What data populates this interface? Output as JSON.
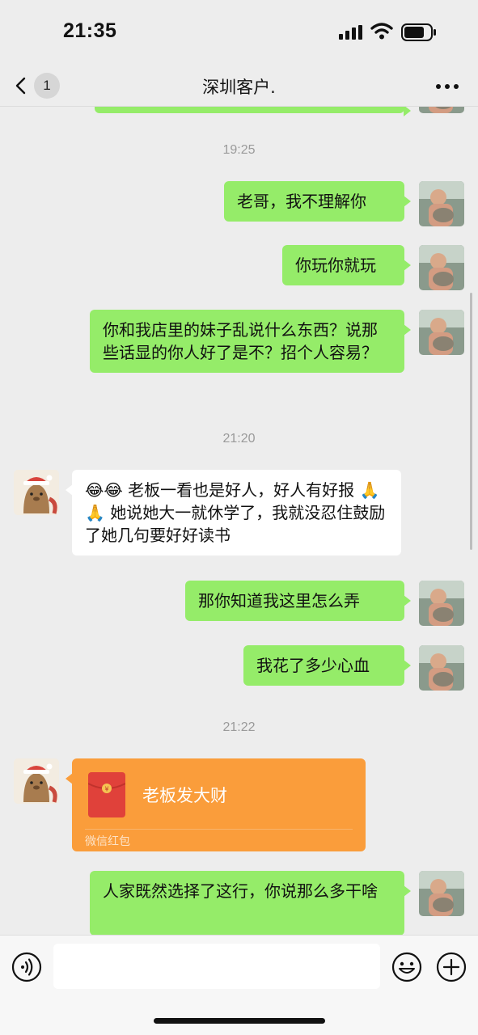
{
  "status_bar": {
    "time": "21:35"
  },
  "nav": {
    "unread_count": "1",
    "title": "深圳客户."
  },
  "timestamps": [
    "19:25",
    "21:20",
    "21:22"
  ],
  "messages": [
    {
      "side": "sent",
      "text": "老哥，我不理解你"
    },
    {
      "side": "sent",
      "text": "你玩你就玩"
    },
    {
      "side": "sent",
      "text": "你和我店里的妹子乱说什么东西？说那些话显的你人好了是不？招个人容易？"
    },
    {
      "side": "recv",
      "text": "😂😂 老板一看也是好人，好人有好报 🙏🙏 她说她大一就休学了，我就没忍住鼓励了她几句要好好读书"
    },
    {
      "side": "sent",
      "text": "那你知道我这里怎么弄"
    },
    {
      "side": "sent",
      "text": "我花了多少心血"
    },
    {
      "side": "sent",
      "text": "人家既然选择了这行，你说那么多干啥"
    }
  ],
  "red_packet": {
    "title": "老板发大财",
    "footer": "微信红包",
    "symbol": "¥"
  },
  "input": {
    "value": ""
  },
  "icons": {
    "back": "chevron-left-icon",
    "more": "more-icon",
    "voice": "voice-icon",
    "emoji": "emoji-icon",
    "plus": "plus-icon"
  },
  "colors": {
    "sent_bubble": "#95ec69",
    "received_bubble": "#ffffff",
    "red_packet": "#fa9d3b",
    "background": "#ededed"
  }
}
